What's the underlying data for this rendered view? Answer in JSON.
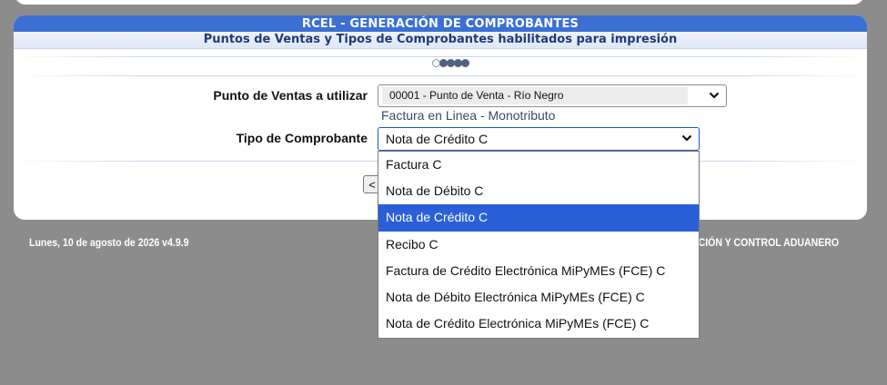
{
  "header": {
    "title": "RCEL - GENERACIÓN DE COMPROBANTES",
    "subtitle": "Puntos de Ventas y Tipos de Comprobantes habilitados para impresión"
  },
  "progress": {
    "total_steps": 5,
    "current_step": 1
  },
  "form": {
    "punto_venta_label": "Punto de Ventas a utilizar",
    "punto_venta_value": "00001 - Punto de Venta - Río Negro",
    "punto_venta_hint": "Factura en Linea - Monotributo",
    "tipo_label": "Tipo de Comprobante",
    "tipo_value": "Nota de Crédito C",
    "back_button_label": "<"
  },
  "dropdown": {
    "options": [
      "Factura C",
      "Nota de Débito C",
      "Nota de Crédito C",
      "Recibo C",
      "Factura de Crédito Electrónica MiPyMEs (FCE) C",
      "Nota de Débito Electrónica MiPyMEs (FCE) C",
      "Nota de Crédito Electrónica MiPyMEs (FCE) C"
    ],
    "selected_index": 2
  },
  "footer": {
    "date_version": "Lunes, 10 de agosto de 2026 v4.9.9",
    "agency_partial": "ACIÓN Y CONTROL ADUANERO"
  },
  "colors": {
    "title_bar": "#3b6fd4",
    "selection": "#2b5fd8",
    "background": "#8c8c8c"
  },
  "icons": {
    "select_arrow": "chevron-down-icon"
  }
}
